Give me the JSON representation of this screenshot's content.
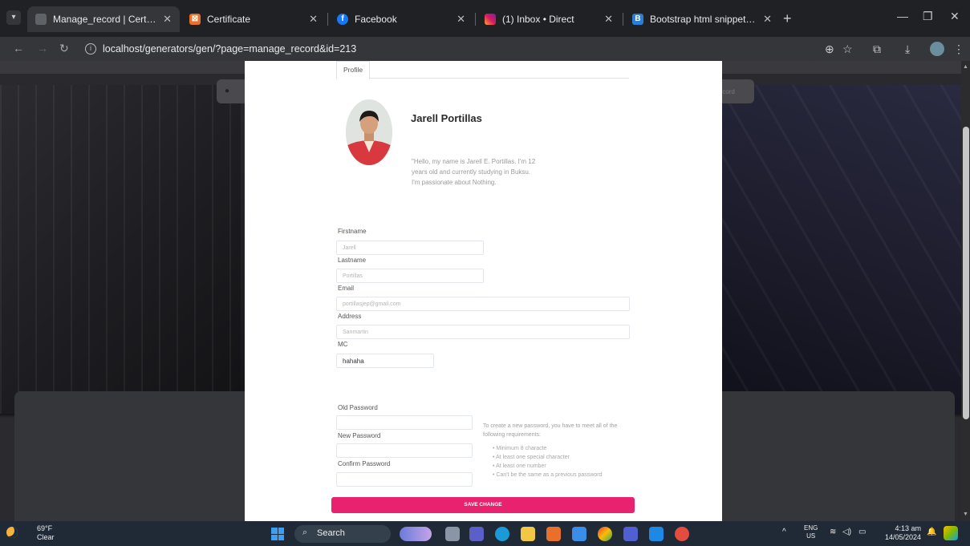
{
  "browser": {
    "tabs": [
      {
        "title": "Manage_record | Certificate Ge",
        "active": true
      },
      {
        "title": "Certificate",
        "active": false
      },
      {
        "title": "Facebook",
        "active": false
      },
      {
        "title": "(1) Inbox • Direct",
        "active": false
      },
      {
        "title": "Bootstrap html snippet. profile",
        "active": false
      }
    ],
    "url": "localhost/generators/gen/?page=manage_record&id=213"
  },
  "modal": {
    "tab_label": "Profile",
    "name": "Jarell Portillas",
    "bio": "\"Hello, my name is Jarell E. Portillas. I'm 12 years old and currently studying in Buksu. I'm passionate about Nothing.",
    "fields": {
      "firstname": {
        "label": "Firstname",
        "value": "Jarell"
      },
      "lastname": {
        "label": "Lastname",
        "value": "Portillas"
      },
      "email": {
        "label": "Email",
        "value": "portillasjep@gmail.com"
      },
      "address": {
        "label": "Address",
        "value": "Sanmartin"
      },
      "mc": {
        "label": "MC",
        "value": "hahaha"
      }
    },
    "password": {
      "old_label": "Old Password",
      "new_label": "New Password",
      "confirm_label": "Confirm Password",
      "help": "To create a new password, you have to meet all of the following requirements:",
      "requirements": [
        "Minimum 8 characte",
        "At least one special character",
        "At least one number",
        "Can't be the same as a previous password"
      ]
    },
    "save_label": "SAVE CHANGE"
  },
  "background": {
    "right_button": "Record"
  },
  "taskbar": {
    "weather_temp": "69°F",
    "weather_desc": "Clear",
    "search_label": "Search",
    "lang_top": "ENG",
    "lang_bottom": "US",
    "time": "4:13 am",
    "date": "14/05/2024"
  }
}
